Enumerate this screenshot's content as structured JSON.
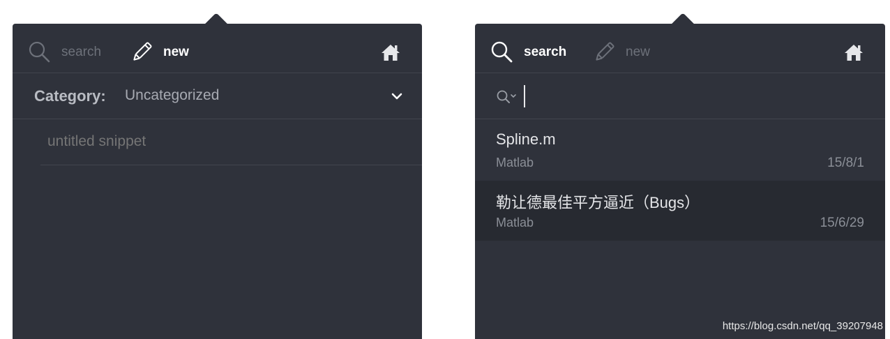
{
  "left_panel": {
    "toolbar": {
      "search_label": "search",
      "new_label": "new",
      "home_icon": "home-icon"
    },
    "category": {
      "label": "Category:",
      "value": "Uncategorized"
    },
    "snippet_title": {
      "placeholder": "untitled snippet",
      "value": ""
    }
  },
  "right_panel": {
    "toolbar": {
      "search_label": "search",
      "new_label": "new",
      "home_icon": "home-icon"
    },
    "search": {
      "value": ""
    },
    "results": [
      {
        "title": "Spline.m",
        "category": "Matlab",
        "date": "15/8/1"
      },
      {
        "title": "勒让德最佳平方逼近（Bugs）",
        "category": "Matlab",
        "date": "15/6/29"
      }
    ]
  },
  "colors": {
    "panel_bg": "#2f323b",
    "divider": "#42454e",
    "selected_row_bg": "#272a31",
    "active_text": "#ffffff",
    "inactive_text": "#6d717a"
  },
  "watermark": "https://blog.csdn.net/qq_39207948"
}
